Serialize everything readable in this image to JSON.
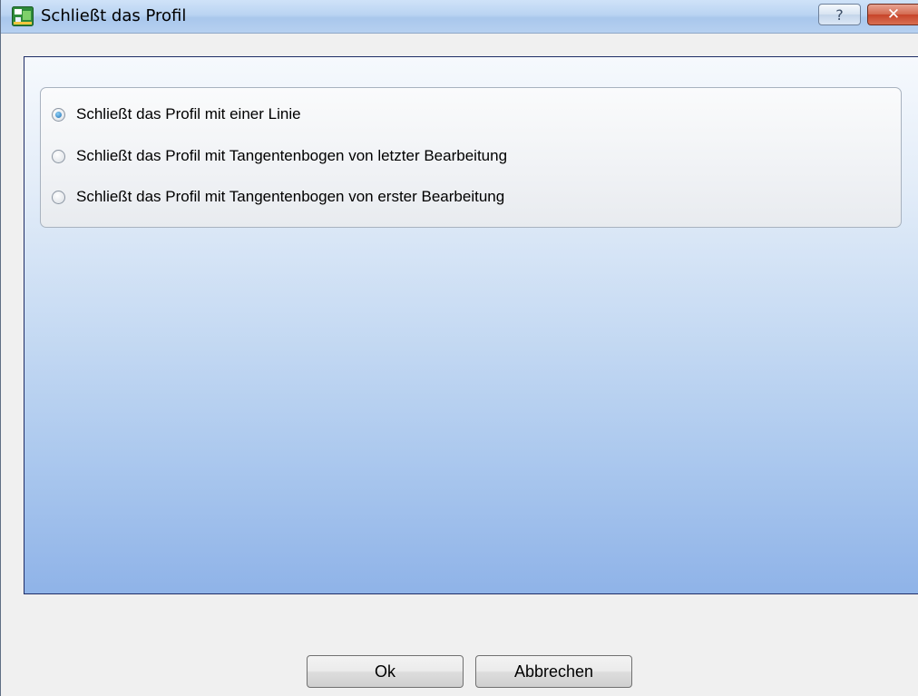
{
  "window": {
    "title": "Schließt das Profil",
    "help_glyph": "?",
    "close_glyph": "✕",
    "app_icon": "profile-tool-icon"
  },
  "options": {
    "items": [
      {
        "label": "Schließt das Profil mit einer Linie",
        "checked": true
      },
      {
        "label": "Schließt das Profil mit Tangentenbogen von letzter Bearbeitung",
        "checked": false
      },
      {
        "label": "Schließt das Profil mit Tangentenbogen von erster Bearbeitung",
        "checked": false
      }
    ]
  },
  "buttons": {
    "ok_label": "Ok",
    "cancel_label": "Abbrechen"
  },
  "colors": {
    "frame_border": "#1f2d66",
    "gradient_top": "#f6f9fd",
    "gradient_bottom": "#8fb3e8",
    "close_red": "#c7442a"
  }
}
